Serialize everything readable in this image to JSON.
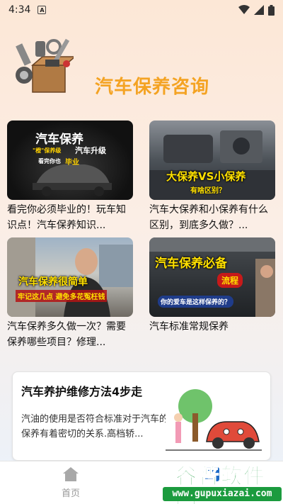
{
  "status": {
    "time": "4:34",
    "notification_letter": "A"
  },
  "header": {
    "title": "汽车保养咨询"
  },
  "cards": [
    {
      "title": "看完你必须毕业的！玩车知识点！汽车保养知识...",
      "overlay": {
        "line1": "汽车保养",
        "line2a": "\"橙\"保养级",
        "line2b": "汽车升级",
        "line3a": "看完你也",
        "line3b": "毕业"
      }
    },
    {
      "title": "汽车大保养和小保养有什么区别，到底多久做？...",
      "overlay": {
        "line1": "大保养VS小保养",
        "line2": "有啥区别？"
      }
    },
    {
      "title": "汽车保养多久做一次？需要保养哪些项目？修理...",
      "overlay": {
        "line1": "汽车保养很简单",
        "line2": "牢记这几点 避免多花冤枉钱"
      }
    },
    {
      "title": "汽车标准常规保养",
      "overlay": {
        "line1": "汽车保养必备",
        "line2": "流程",
        "line3": "你的爱车是这样保养的？"
      }
    }
  ],
  "article": {
    "title": "汽车养护维修方法4步走",
    "body": "汽油的使用是否符合标准对于汽车的保养有着密切的关系.高档轿..."
  },
  "tabs": [
    {
      "label": "首页",
      "active": false
    },
    {
      "label": "咨询",
      "active": true
    }
  ],
  "watermark": {
    "text": "谷普软件园",
    "url": "www.gupuxiazai.com"
  },
  "colors": {
    "title_orange": "#f4a323",
    "active_tab": "#1e6cc8",
    "watermark_green": "#1b9b3e"
  }
}
